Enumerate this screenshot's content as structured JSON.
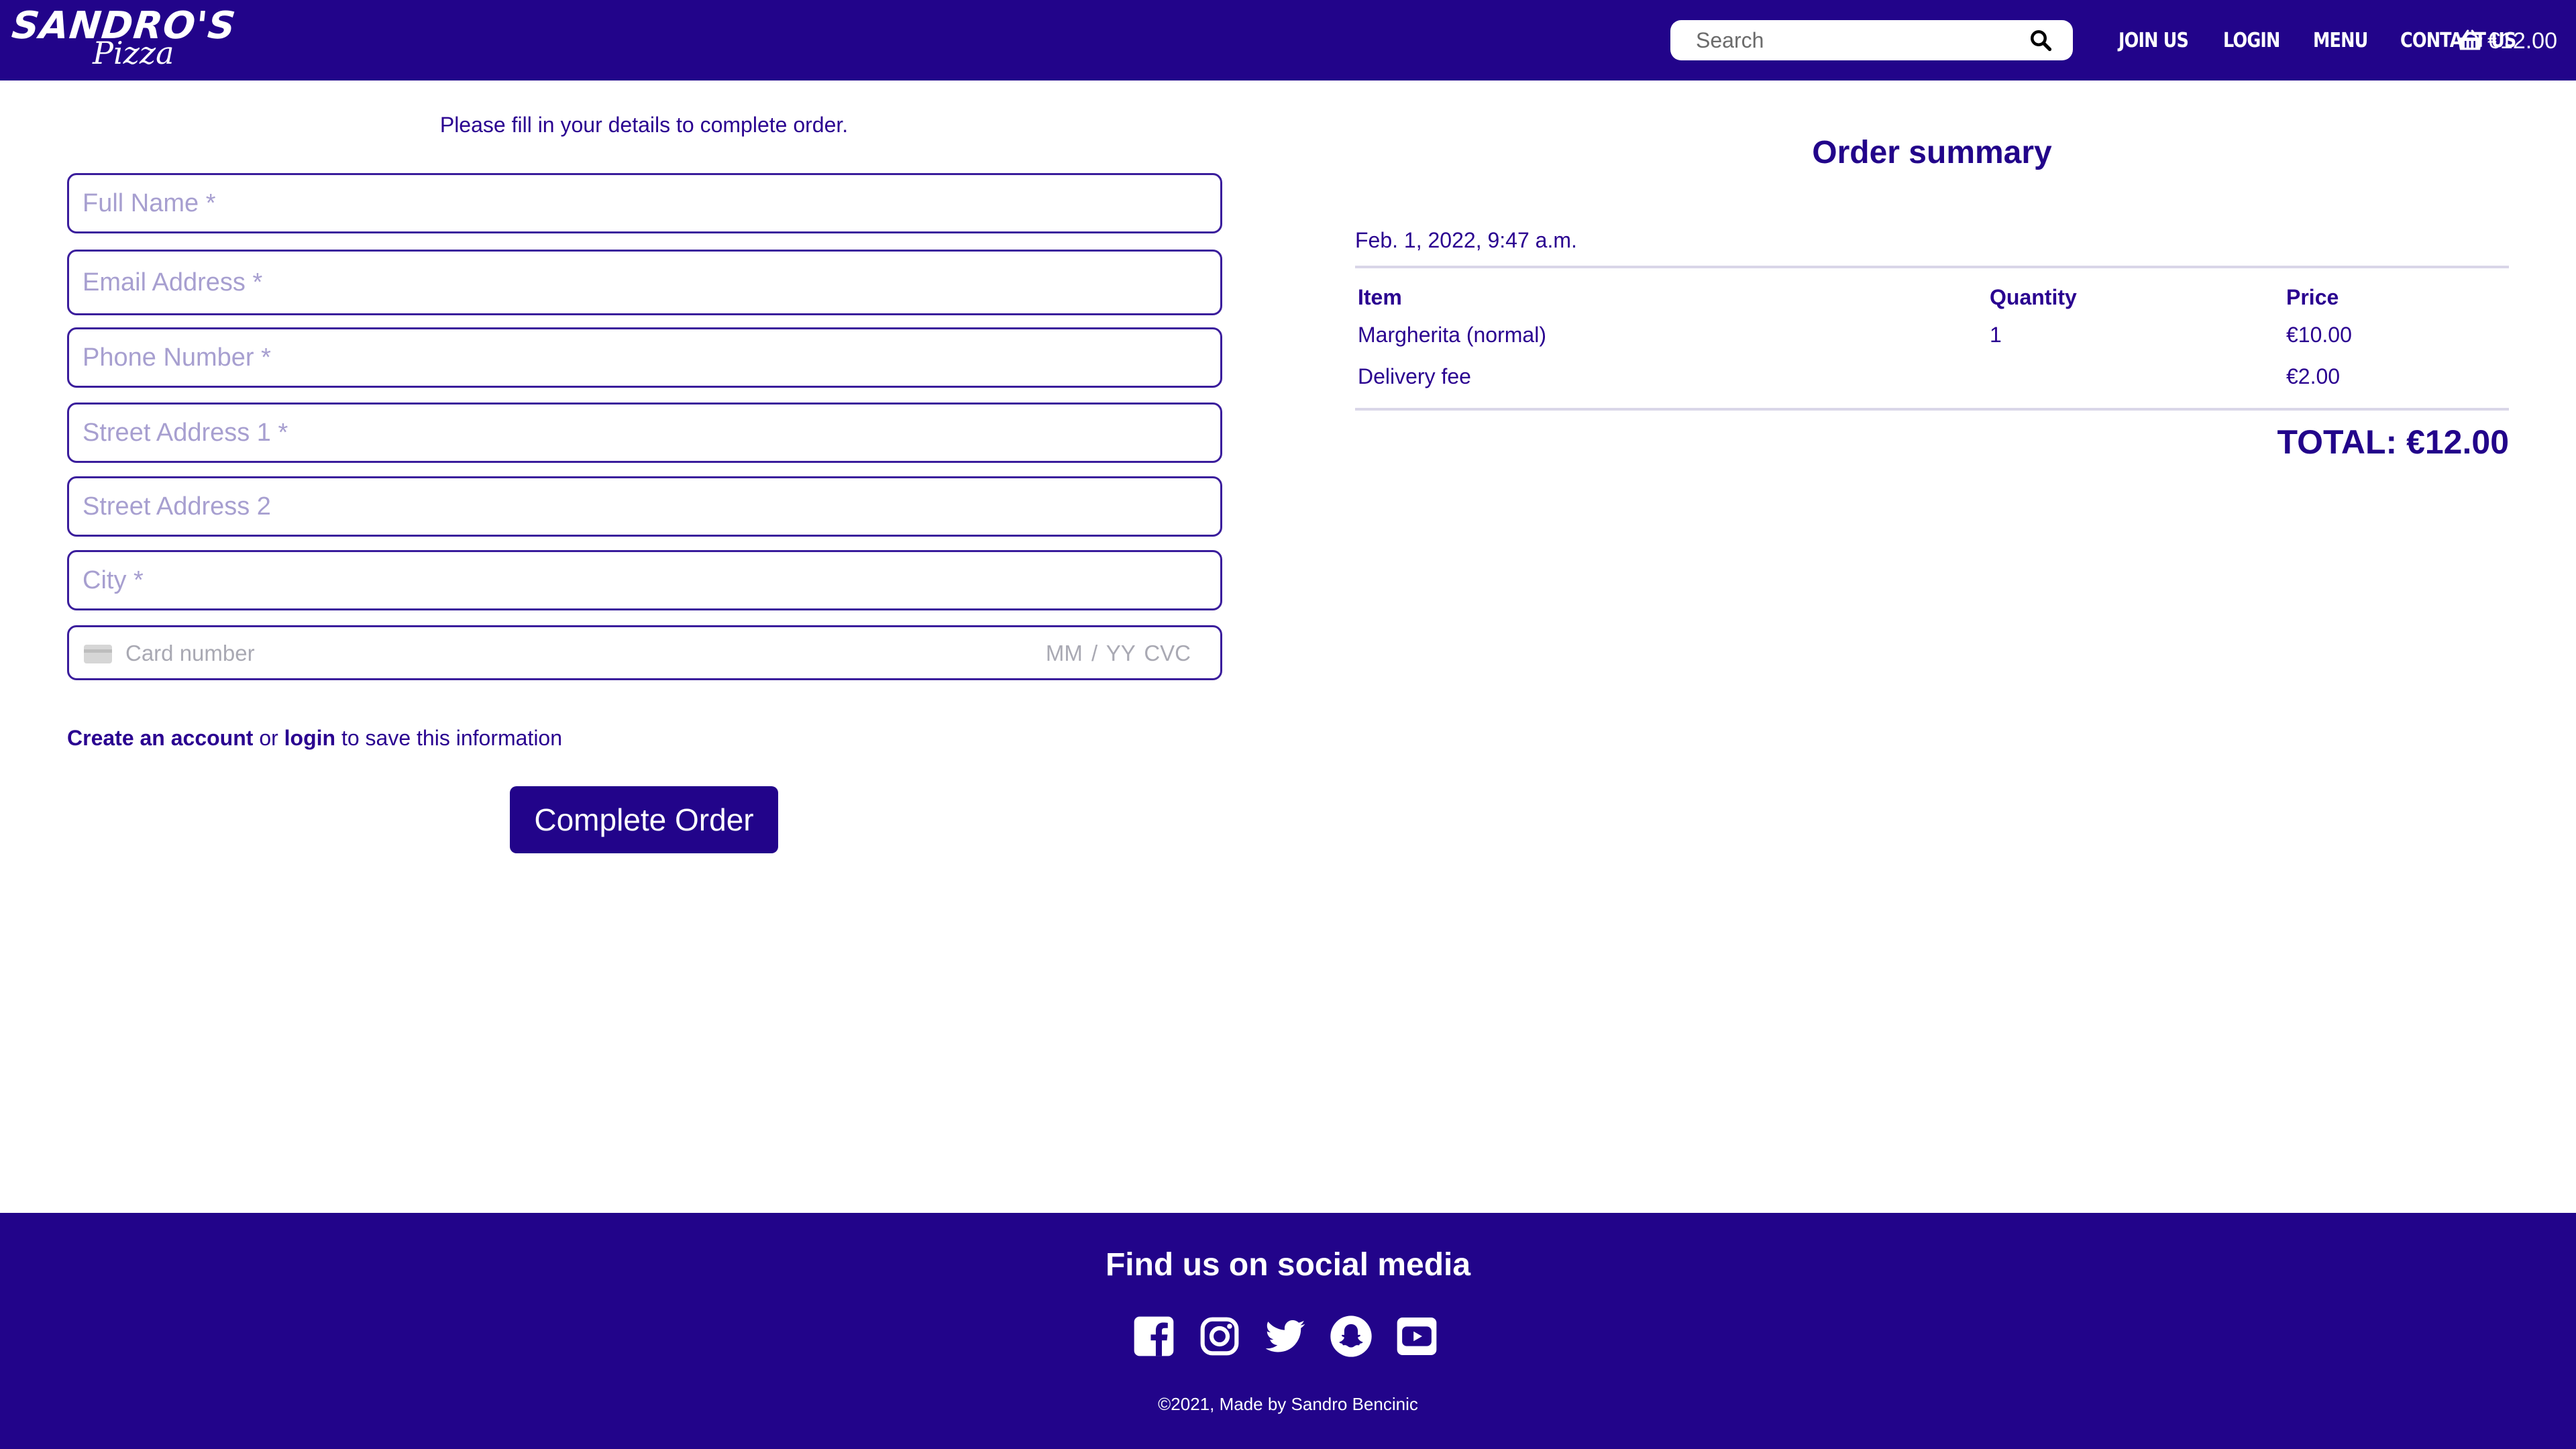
{
  "brand": {
    "logo_top": "SANDRO'S",
    "logo_bottom": "Pizza"
  },
  "header": {
    "search_placeholder": "Search",
    "nav": {
      "join_us": "JOIN US",
      "login": "LOGIN",
      "menu": "MENU",
      "contact_us": "CONTACT US"
    },
    "cart_total": "€12.00"
  },
  "form": {
    "intro": "Please fill in your details to complete order.",
    "fields": {
      "full_name": "Full Name *",
      "email": "Email Address *",
      "phone": "Phone Number *",
      "street1": "Street Address 1 *",
      "street2": "Street Address 2",
      "city": "City *"
    },
    "card": {
      "placeholder": "Card number",
      "expiry_cvc": "MM / YY  CVC"
    },
    "save_info": {
      "create_account": "Create an account",
      "or": " or ",
      "login": "login",
      "suffix": " to save this information"
    },
    "submit_label": "Complete Order"
  },
  "summary": {
    "title": "Order summary",
    "date": "Feb. 1, 2022, 9:47 a.m.",
    "columns": {
      "item": "Item",
      "quantity": "Quantity",
      "price": "Price"
    },
    "rows": [
      {
        "item": "Margherita (normal)",
        "quantity": "1",
        "price": "€10.00"
      },
      {
        "item": "Delivery fee",
        "quantity": "",
        "price": "€2.00"
      }
    ],
    "total": "TOTAL: €12.00"
  },
  "footer": {
    "title": "Find us on social media",
    "social": [
      "facebook-icon",
      "instagram-icon",
      "twitter-icon",
      "snapchat-icon",
      "youtube-icon"
    ],
    "copyright": "©2021, Made by Sandro Bencinic"
  },
  "colors": {
    "primary": "#22048a",
    "text": "#2a0190",
    "placeholder": "#a79fd0"
  }
}
